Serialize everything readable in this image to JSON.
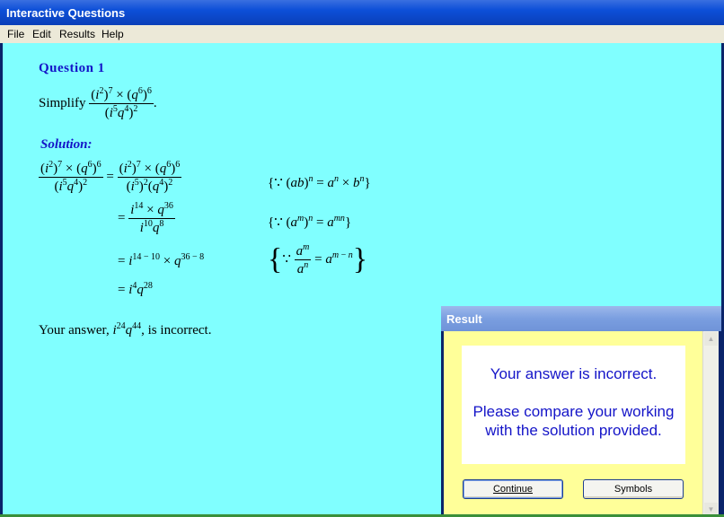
{
  "window": {
    "title": "Interactive Questions"
  },
  "menu": [
    "File",
    "Edit",
    "Results",
    "Help"
  ],
  "question": {
    "heading": "Question 1",
    "prompt": "Simplify"
  },
  "solution": {
    "heading": "Solution:"
  },
  "feedback": {
    "prefix": "Your answer, ",
    "suffix": ", is incorrect."
  },
  "dialog": {
    "title": "Result",
    "message_line1": "Your answer is incorrect.",
    "message_line2": "Please compare your working",
    "message_line3": "with the solution provided.",
    "continue_label": "Continue",
    "symbols_label": "Symbols"
  }
}
